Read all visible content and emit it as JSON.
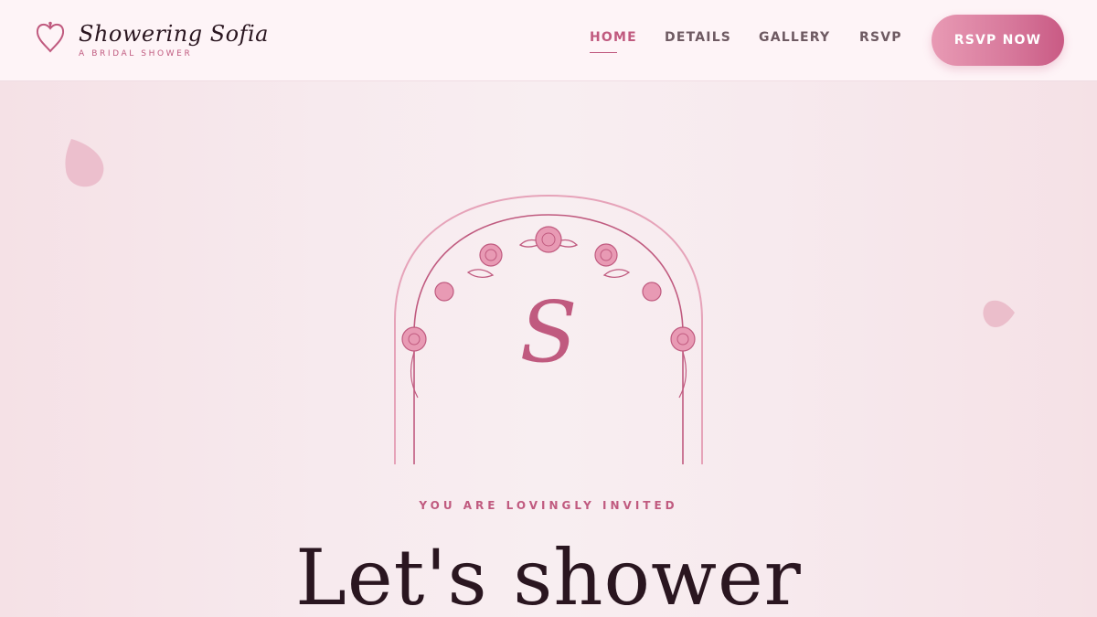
{
  "brand": {
    "title": "Showering Sofia",
    "subtitle": "A BRIDAL SHOWER",
    "icon": "heart-icon"
  },
  "nav": {
    "items": [
      {
        "label": "HOME",
        "active": true
      },
      {
        "label": "DETAILS",
        "active": false
      },
      {
        "label": "GALLERY",
        "active": false
      },
      {
        "label": "RSVP",
        "active": false
      }
    ],
    "cta_label": "RSVP NOW"
  },
  "hero": {
    "monogram": "S",
    "eyebrow": "YOU ARE LOVINGLY INVITED",
    "headline": "Let's shower"
  },
  "colors": {
    "accent": "#c05a7f",
    "accent_light": "#e89ab4",
    "text_dark": "#2a1620",
    "nav_text": "#6e5a62",
    "background": "#f7eaee"
  }
}
